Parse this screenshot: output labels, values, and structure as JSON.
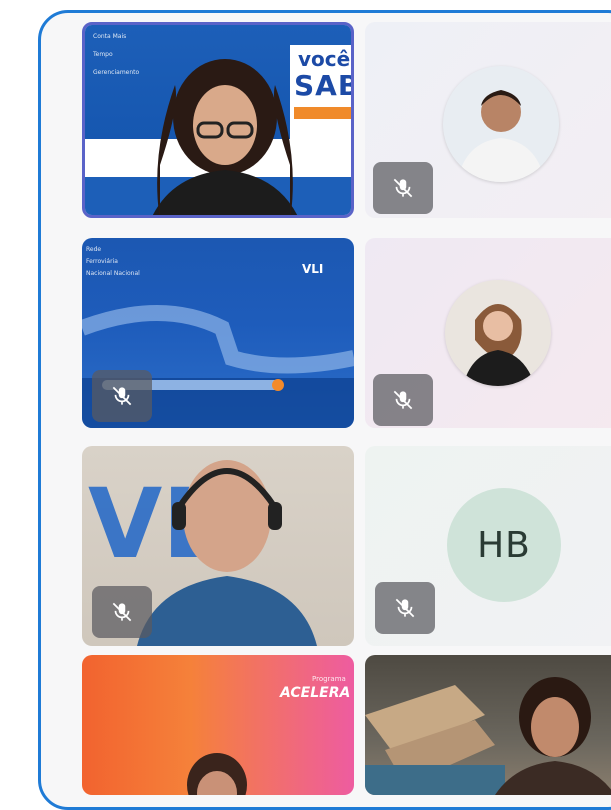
{
  "call": {
    "participants": [
      {
        "id": "p1",
        "video": true,
        "muted": false,
        "active_speaker": true,
        "slide_lines": [
          "Conta Mais",
          "Tempo",
          "Gerenciamento"
        ],
        "sign_word_1": "você",
        "sign_word_2": "SAB"
      },
      {
        "id": "p2",
        "video": false,
        "muted": true,
        "avatar": "photo"
      },
      {
        "id": "p3",
        "video": true,
        "muted": true,
        "screen_share": true,
        "slide_lines": [
          "Rede",
          "Ferroviária",
          "Nacional Nacional"
        ],
        "brand": "VLI"
      },
      {
        "id": "p4",
        "video": false,
        "muted": true,
        "avatar": "photo"
      },
      {
        "id": "p5",
        "video": true,
        "muted": true,
        "brand_bg": "VLI"
      },
      {
        "id": "p6",
        "video": false,
        "muted": true,
        "initials": "HB"
      },
      {
        "id": "p7",
        "video": true,
        "muted": false,
        "promo_small": "Programa",
        "promo_title": "ACELERA"
      },
      {
        "id": "p8",
        "video": true,
        "muted": false
      }
    ]
  },
  "colors": {
    "frame": "#1f7bd6",
    "active_speaker_border": "#5a63c8",
    "initials_bg": "#cfe3d9",
    "mute_badge": "#5a5a5f"
  },
  "icons": {
    "mute": "microphone-off-icon"
  }
}
